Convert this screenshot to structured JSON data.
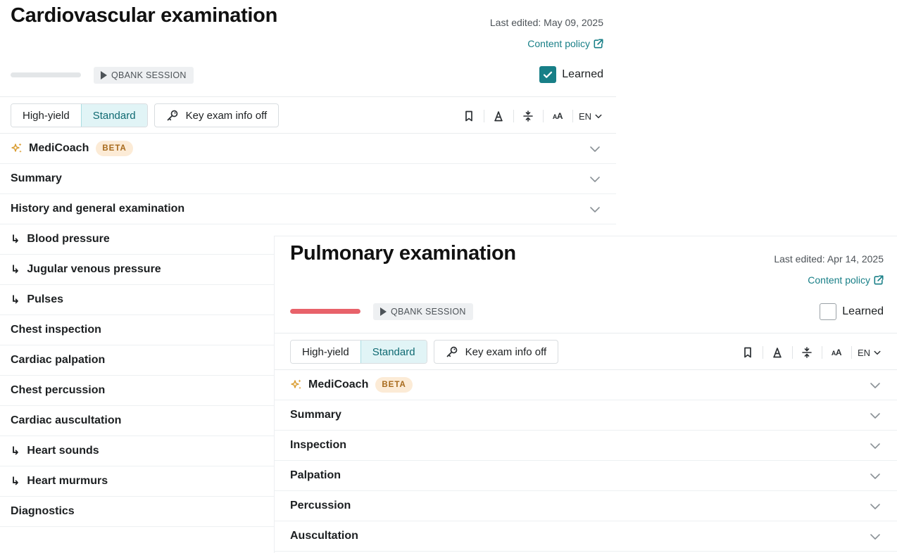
{
  "cardiovascular": {
    "title": "Cardiovascular examination",
    "last_edited": "Last edited: May 09, 2025",
    "content_policy": "Content policy",
    "progress": 0.0,
    "qbank_label": "QBANK SESSION",
    "learned_label": "Learned",
    "learned_checked": true,
    "toolbar": {
      "high_yield": "High-yield",
      "standard": "Standard",
      "key_exam": "Key exam info off",
      "lang": "EN"
    },
    "medicoach": {
      "label": "MediCoach",
      "badge": "BETA"
    },
    "sections": [
      {
        "label": "Summary",
        "sub": false,
        "chevron": true
      },
      {
        "label": "History and general examination",
        "sub": false,
        "chevron": true
      },
      {
        "label": "Blood pressure",
        "sub": true,
        "chevron": false
      },
      {
        "label": "Jugular venous pressure",
        "sub": true,
        "chevron": false
      },
      {
        "label": "Pulses",
        "sub": true,
        "chevron": false
      },
      {
        "label": "Chest inspection",
        "sub": false,
        "chevron": false
      },
      {
        "label": "Cardiac palpation",
        "sub": false,
        "chevron": false
      },
      {
        "label": "Chest percussion",
        "sub": false,
        "chevron": false
      },
      {
        "label": "Cardiac auscultation",
        "sub": false,
        "chevron": false
      },
      {
        "label": "Heart sounds",
        "sub": true,
        "chevron": false
      },
      {
        "label": "Heart murmurs",
        "sub": true,
        "chevron": false
      },
      {
        "label": "Diagnostics",
        "sub": false,
        "chevron": false
      }
    ]
  },
  "pulmonary": {
    "title": "Pulmonary examination",
    "last_edited": "Last edited: Apr 14, 2025",
    "content_policy": "Content policy",
    "progress": 1.0,
    "qbank_label": "QBANK SESSION",
    "learned_label": "Learned",
    "learned_checked": false,
    "toolbar": {
      "high_yield": "High-yield",
      "standard": "Standard",
      "key_exam": "Key exam info off",
      "lang": "EN"
    },
    "medicoach": {
      "label": "MediCoach",
      "badge": "BETA"
    },
    "sections": [
      {
        "label": "Summary",
        "sub": false,
        "chevron": true
      },
      {
        "label": "Inspection",
        "sub": false,
        "chevron": true
      },
      {
        "label": "Palpation",
        "sub": false,
        "chevron": true
      },
      {
        "label": "Percussion",
        "sub": false,
        "chevron": true
      },
      {
        "label": "Auscultation",
        "sub": false,
        "chevron": true
      }
    ]
  },
  "colors": {
    "accent": "#187f87",
    "progress": "#e8626a",
    "beta_bg": "#fcebd6",
    "beta_text": "#a76a1c",
    "active_tab_bg": "#e1f4f6"
  },
  "icons": [
    "external-link-icon",
    "play-icon",
    "check-icon",
    "key-icon",
    "bookmark-icon",
    "highlighter-icon",
    "strikethrough-icon",
    "font-size-icon",
    "chevron-down-icon",
    "sparkle-icon",
    "sub-arrow-icon"
  ]
}
